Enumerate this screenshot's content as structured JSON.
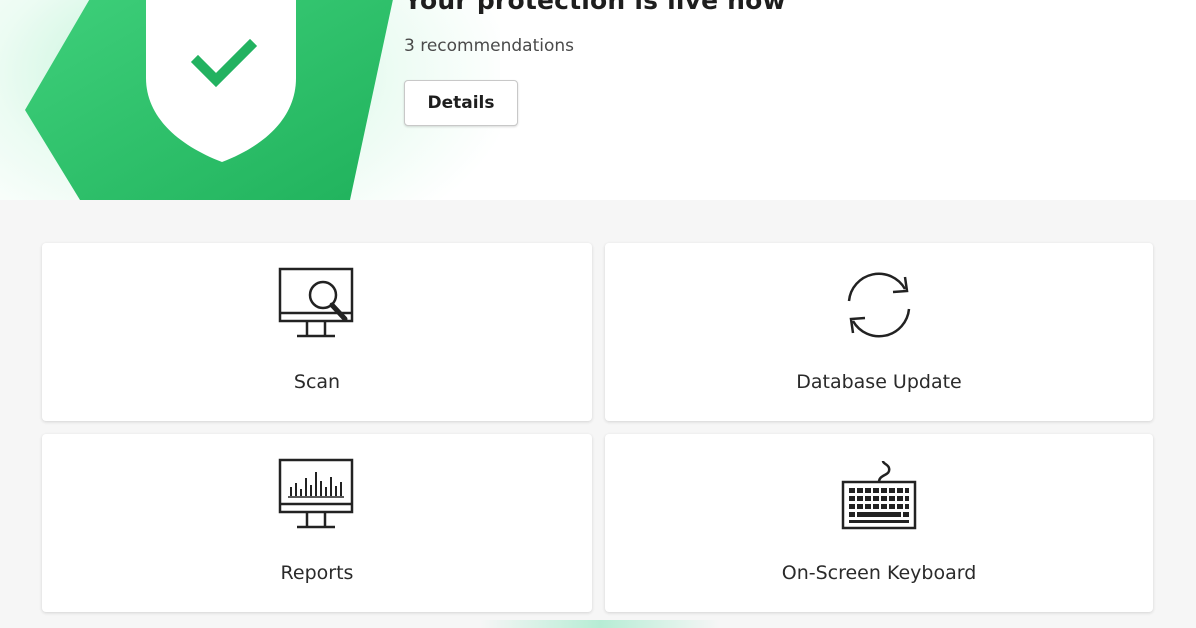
{
  "hero": {
    "title": "Your protection is live now",
    "subtitle": "3 recommendations",
    "details_label": "Details",
    "status_icon": "shield-check-icon",
    "accent_color": "#2ec26a"
  },
  "tiles": [
    {
      "label": "Scan",
      "icon": "monitor-search-icon"
    },
    {
      "label": "Database Update",
      "icon": "refresh-icon"
    },
    {
      "label": "Reports",
      "icon": "monitor-chart-icon"
    },
    {
      "label": "On-Screen Keyboard",
      "icon": "keyboard-icon"
    }
  ]
}
